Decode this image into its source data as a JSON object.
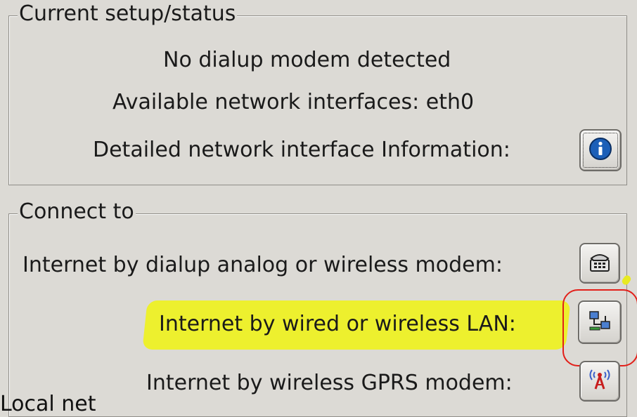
{
  "status_group": {
    "title": "Current setup/status",
    "modem_status": "No dialup modem detected",
    "interfaces_text": "Available network interfaces: eth0",
    "details_label": "Detailed network interface Information:",
    "details_button_icon": "info-icon"
  },
  "connect_group": {
    "title": "Connect to",
    "options": [
      {
        "label": "Internet by dialup analog or wireless modem:",
        "icon": "phone-modem-icon"
      },
      {
        "label": "Internet by wired or wireless LAN:",
        "icon": "lan-network-icon"
      },
      {
        "label": "Internet by wireless GPRS modem:",
        "icon": "gprs-antenna-icon"
      }
    ]
  },
  "colors": {
    "background": "#dcdad5",
    "highlight": "#eef21c",
    "annotation_red": "#e2201a",
    "info_blue": "#1c5fb8"
  },
  "clipped_bottom_text": "Local net"
}
